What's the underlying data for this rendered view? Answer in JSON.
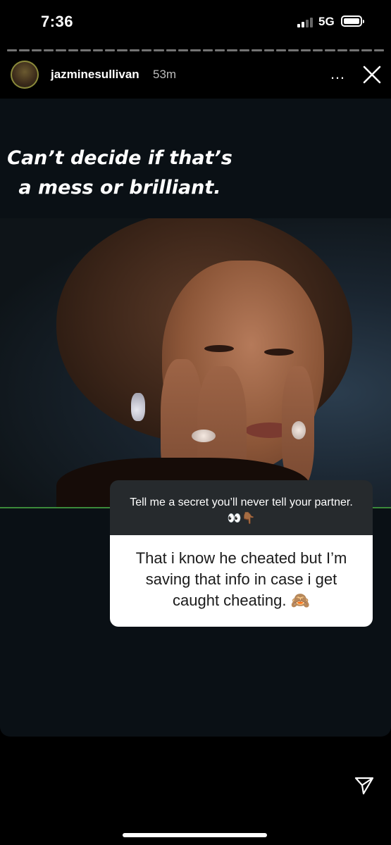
{
  "status_bar": {
    "time": "7:36",
    "network": "5G",
    "signal_bars": 4,
    "signal_bars_active": 2
  },
  "progress": {
    "segments": 31
  },
  "story_header": {
    "username": "jazminesullivan",
    "elapsed": "53m",
    "more_icon": "…",
    "close_icon": "close-icon"
  },
  "story": {
    "caption_line1": "Can’t decide if that’s",
    "caption_line2": "a mess or brilliant.",
    "question": {
      "prompt": "Tell me a secret you’ll never tell your partner. 👀👇🏾",
      "answer": "That i know he cheated but I’m saving that info in case i get caught cheating. 🙈"
    }
  },
  "footer": {
    "share_icon": "paper-plane-icon"
  },
  "colors": {
    "background": "#000000",
    "card": "#0a1015",
    "question_header": "#262a2d",
    "accent_line": "#3b8a3a"
  }
}
